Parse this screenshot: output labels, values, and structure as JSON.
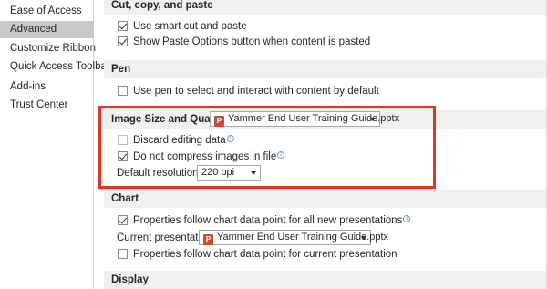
{
  "sidebar": {
    "items": [
      {
        "label": "Ease of Access"
      },
      {
        "label": "Advanced"
      },
      {
        "label": "Customize Ribbon"
      },
      {
        "label": "Quick Access Toolbar"
      },
      {
        "label": "Add-ins"
      },
      {
        "label": "Trust Center"
      }
    ]
  },
  "sections": {
    "cut_copy_paste": {
      "title": "Cut, copy, and paste",
      "smart_cut": {
        "label": "Use smart cut and paste",
        "checked": true
      },
      "paste_options": {
        "label": "Show Paste Options button when content is pasted",
        "checked": true
      }
    },
    "pen": {
      "title": "Pen",
      "use_pen": {
        "label": "Use pen to select and interact with content by default",
        "checked": false
      }
    },
    "image_size": {
      "title": "Image Size and Quality",
      "file_dropdown": "Yammer End User Training Guide.pptx",
      "discard_editing": {
        "label": "Discard editing data",
        "checked": false
      },
      "no_compress": {
        "label": "Do not compress images in file",
        "checked": true
      },
      "default_resolution_label": "Default resolution:",
      "default_resolution_value": "220 ppi"
    },
    "chart": {
      "title": "Chart",
      "follow_all": {
        "label": "Properties follow chart data point for all new presentations",
        "checked": true
      },
      "current_presentation_label": "Current presentation:",
      "current_presentation_value": "Yammer End User Training Guide.pptx",
      "follow_current": {
        "label": "Properties follow chart data point for current presentation",
        "checked": false
      }
    },
    "display": {
      "title": "Display"
    }
  },
  "icons": {
    "file_icon": "powerpoint-file-icon",
    "info": "info-icon",
    "caret": "chevron-down-icon",
    "ppt_letter": "P"
  },
  "colors": {
    "highlight": "#e53420",
    "selected_nav": "#c8c8c8",
    "section_header": "#f0f0f0",
    "ppt_icon": "#d04a2b"
  }
}
